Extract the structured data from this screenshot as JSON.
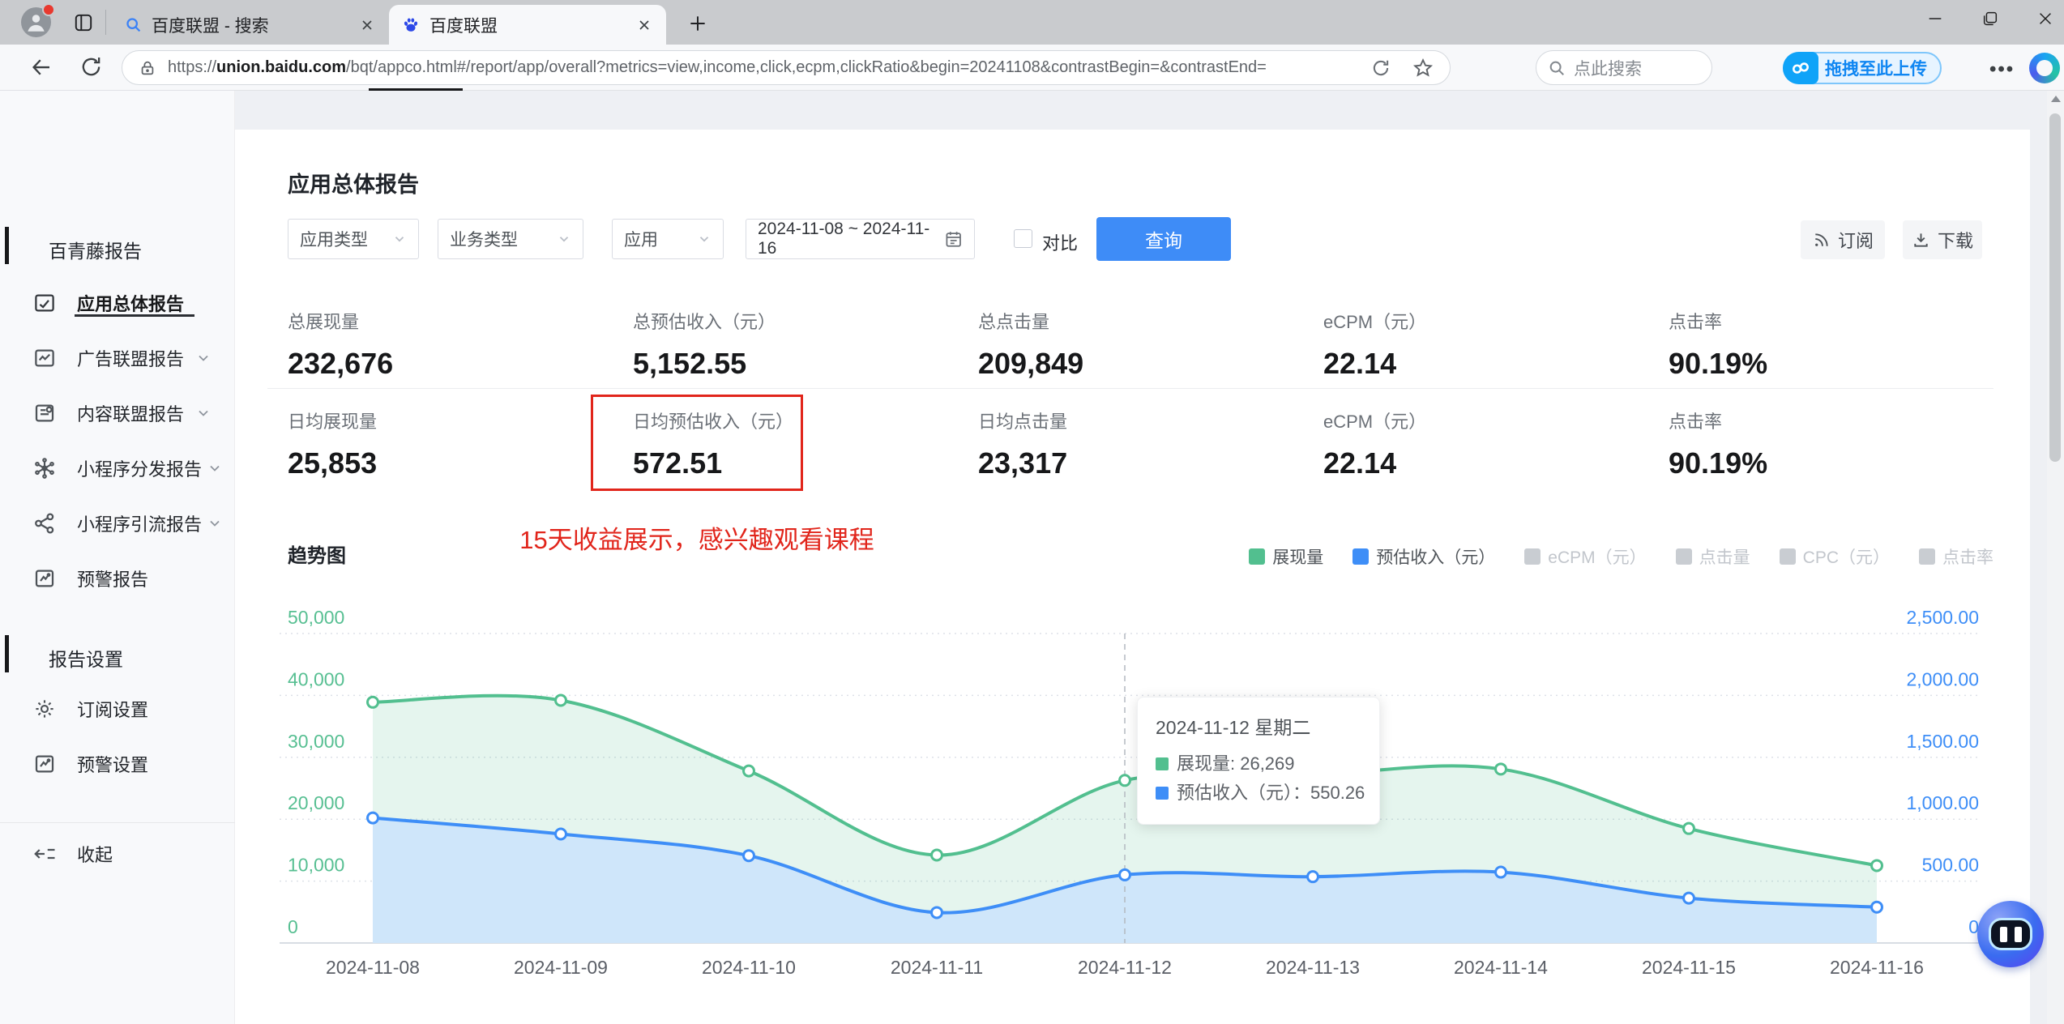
{
  "browser": {
    "tabs": [
      {
        "title": "百度联盟 - 搜索",
        "icon": "search-favicon",
        "active": false
      },
      {
        "title": "百度联盟",
        "icon": "baidu-favicon",
        "active": true
      }
    ],
    "url_prefix": "https://",
    "url_host": "union.baidu.com",
    "url_rest": "/bqt/appco.html#/report/app/overall?metrics=view,income,click,ecpm,clickRatio&begin=20241108&contrastBegin=&contrastEnd=",
    "search_placeholder": "点此搜索",
    "upload_button_label": "拖拽至此上传"
  },
  "sidebar": {
    "sections": [
      {
        "title": "百青藤报告",
        "items": [
          {
            "label": "应用总体报告",
            "active": true
          },
          {
            "label": "广告联盟报告",
            "expandable": true
          },
          {
            "label": "内容联盟报告",
            "expandable": true
          },
          {
            "label": "小程序分发报告",
            "expandable": true
          },
          {
            "label": "小程序引流报告",
            "expandable": true
          },
          {
            "label": "预警报告"
          }
        ]
      },
      {
        "title": "报告设置",
        "items": [
          {
            "label": "订阅设置"
          },
          {
            "label": "预警设置"
          }
        ]
      }
    ],
    "collapse_label": "收起"
  },
  "page": {
    "title": "应用总体报告",
    "filters": {
      "app_type": "应用类型",
      "business_type": "业务类型",
      "app": "应用",
      "date_range": "2024-11-08 ~ 2024-11-16",
      "compare_label": "对比",
      "query_button": "查询",
      "subscribe_button": "订阅",
      "download_button": "下载"
    },
    "metrics": {
      "row1": [
        {
          "label": "总展现量",
          "value": "232,676"
        },
        {
          "label": "总预估收入（元）",
          "value": "5,152.55"
        },
        {
          "label": "总点击量",
          "value": "209,849"
        },
        {
          "label": "eCPM（元）",
          "value": "22.14"
        },
        {
          "label": "点击率",
          "value": "90.19%"
        }
      ],
      "row2": [
        {
          "label": "日均展现量",
          "value": "25,853"
        },
        {
          "label": "日均预估收入（元）",
          "value": "572.51",
          "highlighted": true
        },
        {
          "label": "日均点击量",
          "value": "23,317"
        },
        {
          "label": "eCPM（元）",
          "value": "22.14"
        },
        {
          "label": "点击率",
          "value": "90.19%"
        }
      ]
    },
    "annotation": "15天收益展示，感兴趣观看课程",
    "chart_title": "趋势图"
  },
  "chart_data": {
    "type": "area",
    "title": "趋势图",
    "x": [
      "2024-11-08",
      "2024-11-09",
      "2024-11-10",
      "2024-11-11",
      "2024-11-12",
      "2024-11-13",
      "2024-11-14",
      "2024-11-15",
      "2024-11-16"
    ],
    "series": [
      {
        "name": "展现量",
        "color": "#52bf8f",
        "axis": "left",
        "values": [
          38900,
          39200,
          27800,
          14200,
          26269,
          27200,
          28100,
          18500,
          12507
        ]
      },
      {
        "name": "预估收入（元）",
        "color": "#3e8ef7",
        "axis": "right",
        "area_fill": "#cfe6fa",
        "values": [
          1010.5,
          880.2,
          705.4,
          245.8,
          550.26,
          535.6,
          572.3,
          362.49,
          290.0
        ]
      }
    ],
    "legend": [
      {
        "label": "展现量",
        "color": "#52bf8f",
        "active": true
      },
      {
        "label": "预估收入（元）",
        "color": "#3e8ef7",
        "active": true
      },
      {
        "label": "eCPM（元）",
        "color": "#c9cdd2",
        "active": false
      },
      {
        "label": "点击量",
        "color": "#c9cdd2",
        "active": false
      },
      {
        "label": "CPC（元）",
        "color": "#c9cdd2",
        "active": false
      },
      {
        "label": "点击率",
        "color": "#c9cdd2",
        "active": false
      }
    ],
    "left_axis": {
      "ticks": [
        "0",
        "10,000",
        "20,000",
        "30,000",
        "40,000",
        "50,000"
      ],
      "max": 50000,
      "color": "#57bf92"
    },
    "right_axis": {
      "ticks": [
        "0",
        "500.00",
        "1,000.00",
        "1,500.00",
        "2,000.00",
        "2,500.00"
      ],
      "max": 2500,
      "color": "#3e8ef7"
    },
    "grid": true,
    "legend_position": "top-right",
    "tooltip": {
      "index": 4,
      "title": "2024-11-12 星期二",
      "rows": [
        {
          "text": "展现量: 26,269",
          "color": "#52bf8f"
        },
        {
          "text": "预估收入（元）：550.26",
          "color": "#3e8ef7"
        }
      ]
    }
  }
}
